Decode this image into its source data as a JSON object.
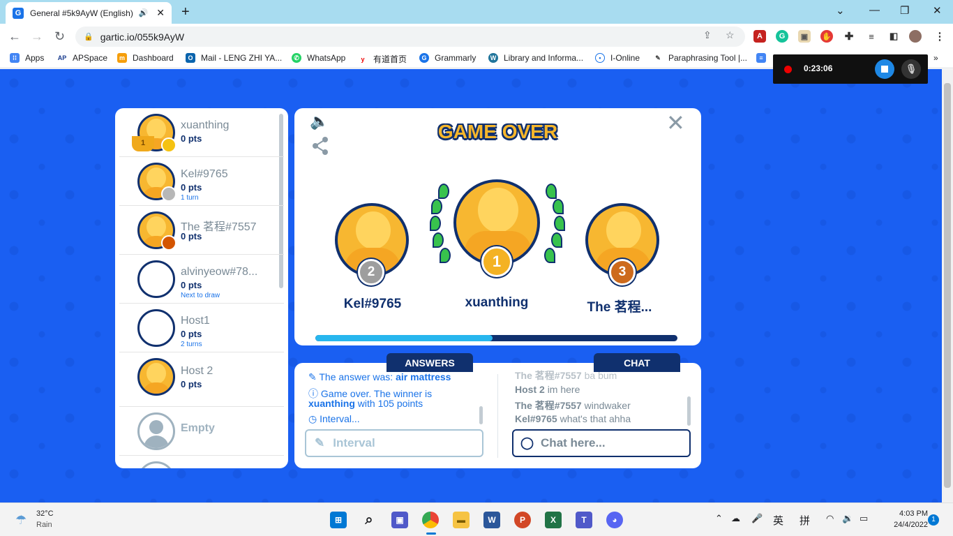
{
  "browser": {
    "tab_title": "General #5k9AyW (English) -",
    "tab_favicon": "G",
    "url": "gartic.io/055k9AyW",
    "bookmarks": [
      "Apps",
      "APSpace",
      "Dashboard",
      "Mail - LENG ZHI YA...",
      "WhatsApp",
      "有道首页",
      "Grammarly",
      "Library and Informa...",
      "I-Online",
      "Paraphrasing Tool |..."
    ],
    "overflow": "»"
  },
  "recorder": {
    "time": "0:23:06"
  },
  "players": [
    {
      "name": "xuanthing",
      "pts": "0 pts",
      "note": "",
      "rank": "1",
      "badge_color": "#f5c211"
    },
    {
      "name": "Kel#9765",
      "pts": "0 pts",
      "note": "1 turn",
      "badge_color": "#b7b7b7"
    },
    {
      "name": "The 茗程#7557",
      "pts": "0 pts",
      "note": "",
      "badge_color": "#d35400"
    },
    {
      "name": "alvinyeow#78...",
      "pts": "0 pts",
      "note": "Next to draw"
    },
    {
      "name": "Host1",
      "pts": "0 pts",
      "note": "2 turns"
    },
    {
      "name": "Host 2",
      "pts": "0 pts",
      "note": ""
    },
    {
      "name": "Empty",
      "pts": "",
      "note": ""
    }
  ],
  "game": {
    "title": "GAME OVER",
    "podium": [
      {
        "place": "2",
        "name": "Kel#9765"
      },
      {
        "place": "1",
        "name": "xuanthing"
      },
      {
        "place": "3",
        "name": "The 茗程..."
      }
    ],
    "progress": 0.49
  },
  "answers": {
    "header": "ANSWERS",
    "line1_prefix": "The answer was: ",
    "line1_answer": "air mattress",
    "line2_a": "Game over. The winner is",
    "line2_winner": "xuanthing",
    "line2_b": " with 105 points",
    "line3": "Interval...",
    "input_placeholder": "Interval"
  },
  "chat": {
    "header": "CHAT",
    "messages": [
      {
        "user": "The 茗程#7557",
        "text": "ba bum"
      },
      {
        "user": "Host 2",
        "text": "im here"
      },
      {
        "user": "The 茗程#7557",
        "text": "windwaker"
      },
      {
        "user": "Kel#9765",
        "text": "what's that ahha"
      }
    ],
    "input_placeholder": "Chat here..."
  },
  "taskbar": {
    "temp": "32°C",
    "weather": "Rain",
    "time": "4:03 PM",
    "date": "24/4/2022",
    "ime1": "英",
    "ime2": "拼",
    "notif": "1"
  }
}
